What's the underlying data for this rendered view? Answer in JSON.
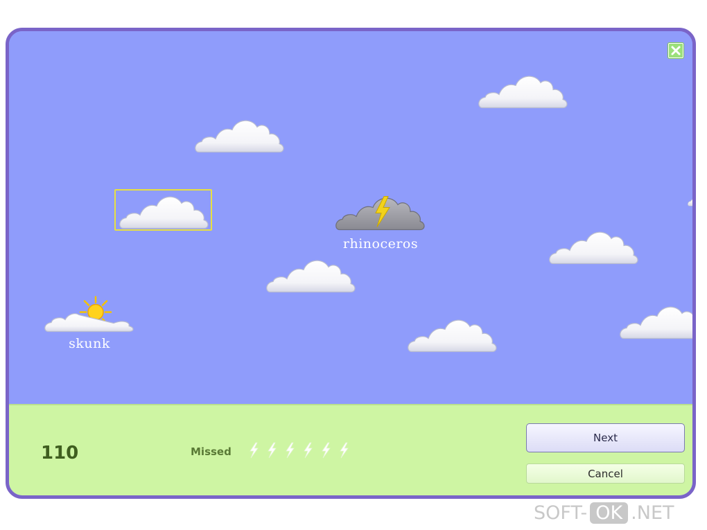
{
  "game": {
    "words": {
      "skunk": "skunk",
      "rhinoceros": "rhinoceros"
    },
    "score": "110",
    "missed_label": "Missed",
    "missed_count": 6,
    "next_label": "Next",
    "cancel_label": "Cancel"
  },
  "icons": {
    "close": "close-icon",
    "sun": "sun-icon",
    "lightning": "lightning-icon"
  },
  "colors": {
    "sky": "#8f9cfb",
    "ground": "#cef5a3",
    "frame": "#7a64c8",
    "selection": "#e8e040",
    "bolt": "#f2d21c"
  },
  "watermark": {
    "soft": "SOFT-",
    "ok": "OK",
    "net": ".NET"
  }
}
